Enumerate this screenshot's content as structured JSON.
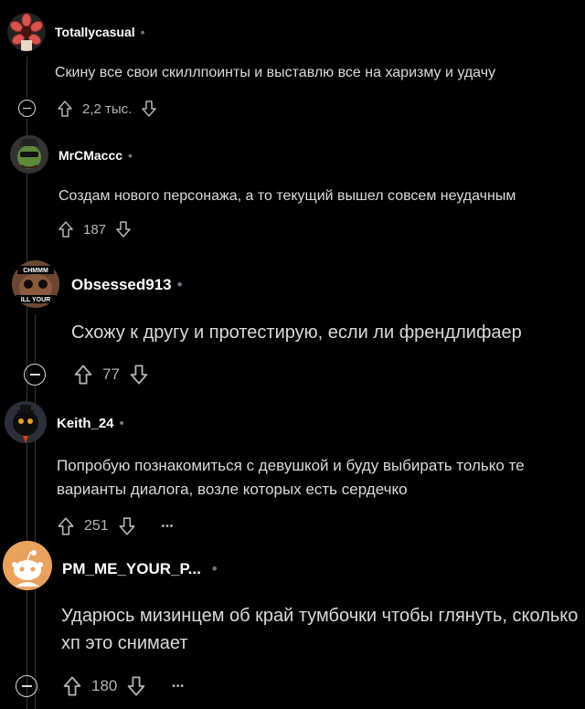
{
  "comments": [
    {
      "username": "Totallycasual",
      "text": "Скину все свои скиллпоинты и выставлю все на харизму и удачу",
      "votes": "2,2 тыс."
    },
    {
      "username": "MrCMaccc",
      "text": "Создам нового персонажа, а то текущий вышел совсем неудачным",
      "votes": "187"
    },
    {
      "username": "Obsessed913",
      "text": "Схожу к другу и протестирую, если ли френдлифаер",
      "votes": "77",
      "avatar_text_top": "CHMMM",
      "avatar_text_bottom": "ILL YOUR"
    },
    {
      "username": "Keith_24",
      "text": "Попробую познакомиться с девушкой и буду выбирать только те варианты диалога, возле которых есть сердечко",
      "votes": "251",
      "more": "•••"
    },
    {
      "username": "PM_ME_YOUR_P...",
      "text": "Ударюсь мизинцем об край тумбочки чтобы глянуть, сколько хп это снимает",
      "votes": "180",
      "more": "•••"
    }
  ],
  "separator": "•",
  "colors": {
    "background": "#000000",
    "text": "#d7dadc",
    "line": "#343536",
    "meta": "#b0b4b8"
  }
}
